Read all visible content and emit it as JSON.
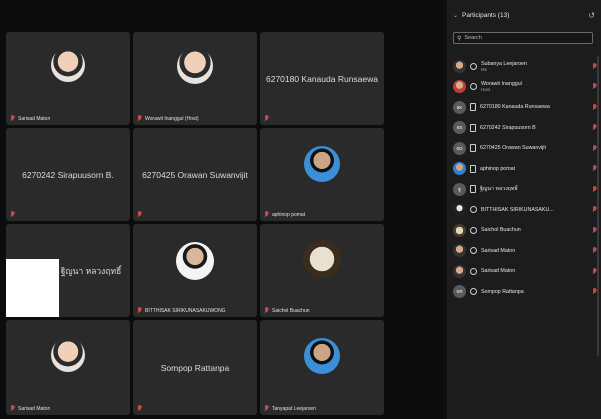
{
  "tiles": [
    {
      "id": "t1",
      "bottom_label": "Sarisad Maton",
      "center_name": "",
      "avatar": "photo"
    },
    {
      "id": "t2",
      "bottom_label": "Worawit Inanggul (Host)",
      "center_name": "",
      "avatar": "photo"
    },
    {
      "id": "t3",
      "bottom_label": "",
      "center_name": "6270180 Kanauda Runsaewa",
      "avatar": ""
    },
    {
      "id": "t4",
      "bottom_label": "",
      "center_name": "6270242 Sirapuusorn B.",
      "avatar": ""
    },
    {
      "id": "t5",
      "bottom_label": "",
      "center_name": "6270425 Orawan Suwanvijit",
      "avatar": ""
    },
    {
      "id": "t6",
      "bottom_label": "aphinop pomat",
      "center_name": "",
      "avatar": "blue"
    },
    {
      "id": "t7",
      "bottom_label": "",
      "center_name": "ฐิญนา หลวงฤทธิ์",
      "avatar": ""
    },
    {
      "id": "t8",
      "bottom_label": "BITTHISAK SIRIKUNASAKUWONG",
      "center_name": "",
      "avatar": "white"
    },
    {
      "id": "t9",
      "bottom_label": "Saichol Buachun",
      "center_name": "",
      "avatar": "logo"
    },
    {
      "id": "t10",
      "bottom_label": "Sarisad Maton",
      "center_name": "",
      "avatar": "photo"
    },
    {
      "id": "t11",
      "bottom_label": "",
      "center_name": "Sompop Rattanpa",
      "avatar": ""
    },
    {
      "id": "t12",
      "bottom_label": "Tanyapat Leejaroen",
      "center_name": "",
      "avatar": "blue"
    }
  ],
  "panel": {
    "title": "Participants (13)",
    "search_placeholder": "Search",
    "participants": [
      {
        "name": "Subanya Leejaroen",
        "sub": "Me",
        "avatar": "photo",
        "initials": ""
      },
      {
        "name": "Worawit Inanggul",
        "sub": "Host",
        "avatar": "red",
        "initials": ""
      },
      {
        "name": "6270180 Kanauda Runsaewa",
        "sub": "",
        "avatar": "gray",
        "initials": "6K"
      },
      {
        "name": "6270242 Sirapuusorn B",
        "sub": "",
        "avatar": "gray",
        "initials": "6S"
      },
      {
        "name": "6270425 Orawan Suwanvijit",
        "sub": "",
        "avatar": "gray",
        "initials": "6O"
      },
      {
        "name": "aphinop pomat",
        "sub": "",
        "avatar": "blue",
        "initials": ""
      },
      {
        "name": "ฐิญนา หลวงฤทธิ์",
        "sub": "",
        "avatar": "gray",
        "initials": "ฐ"
      },
      {
        "name": "BITTHISAK SIRIKUNASAKU...",
        "sub": "",
        "avatar": "dark",
        "initials": ""
      },
      {
        "name": "Saichol Buachun",
        "sub": "",
        "avatar": "logo",
        "initials": ""
      },
      {
        "name": "Sarisad Maton",
        "sub": "",
        "avatar": "photo",
        "initials": ""
      },
      {
        "name": "Sarisad Maton",
        "sub": "",
        "avatar": "photo",
        "initials": ""
      },
      {
        "name": "Sompop Rattanpa",
        "sub": "",
        "avatar": "gray",
        "initials": "SR"
      }
    ]
  },
  "icons": {
    "mic": "mic-muted-icon",
    "search": "search-icon",
    "chevron": "chevron-down-icon",
    "popout": "popout-icon"
  },
  "colors": {
    "background": "#0c0c0c",
    "tile": "#2a2a2a",
    "panel": "#1c1c1c",
    "muted_mic": "#c24a4a"
  }
}
